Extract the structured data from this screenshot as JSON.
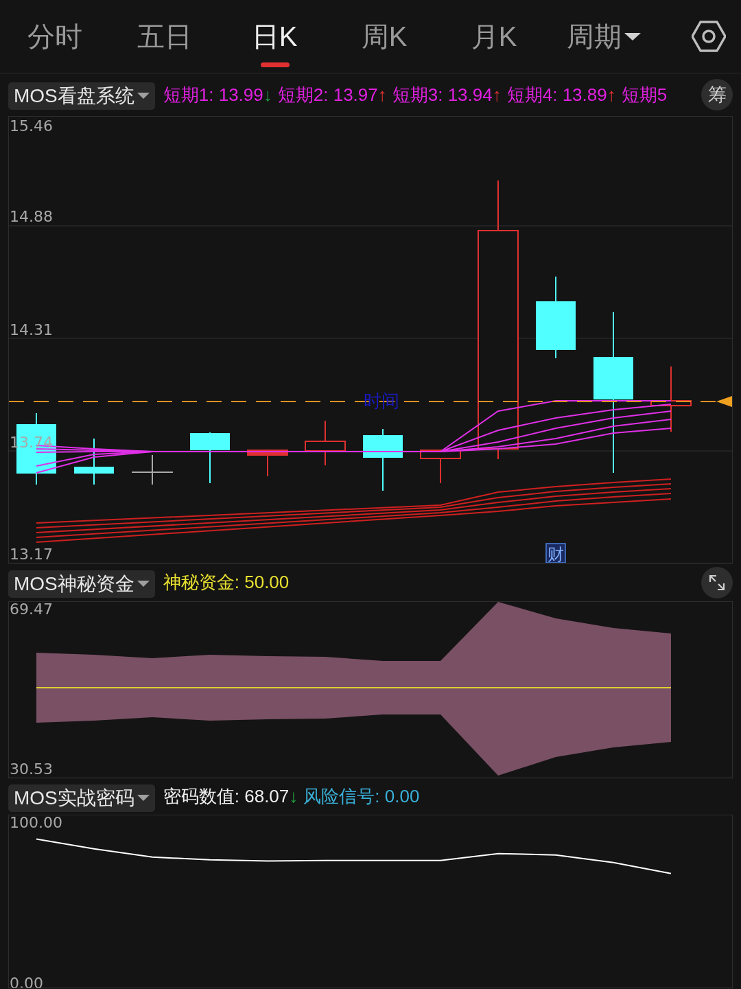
{
  "tabs": [
    {
      "label": "分时",
      "selected": false,
      "kind": "plain"
    },
    {
      "label": "五日",
      "selected": false,
      "kind": "plain"
    },
    {
      "label": "日K",
      "selected": true,
      "kind": "plain"
    },
    {
      "label": "周K",
      "selected": false,
      "kind": "plain"
    },
    {
      "label": "月K",
      "selected": false,
      "kind": "plain"
    },
    {
      "label": "周期",
      "selected": false,
      "kind": "dropdown"
    }
  ],
  "panels": [
    {
      "kind": "candles",
      "indicator": "MOS看盘系统",
      "tool": {
        "kind": "text",
        "text": "筹"
      },
      "legend": [
        {
          "text": "短期1: 13.99",
          "arrow": {
            "text": "↓",
            "color": "#20a040"
          },
          "color": "#e020e0"
        },
        {
          "text": "短期2: 13.97",
          "arrow": {
            "text": "↑",
            "color": "#e03030"
          },
          "color": "#e020e0"
        },
        {
          "text": "短期3: 13.94",
          "arrow": {
            "text": "↑",
            "color": "#e03030"
          },
          "color": "#e020e0"
        },
        {
          "text": "短期4: 13.89",
          "arrow": {
            "text": "↑",
            "color": "#e03030"
          },
          "color": "#e020e0"
        },
        {
          "text": "短期5",
          "color": "#e020e0"
        }
      ],
      "y_labels": [
        "15.46",
        "14.88",
        "14.31",
        "13.74",
        "13.17"
      ],
      "markers": {
        "time": "时间",
        "finance": "财"
      }
    },
    {
      "kind": "band",
      "indicator": "MOS神秘资金",
      "tool": {
        "kind": "expand"
      },
      "legend": [
        {
          "text": "神秘资金: 50.00",
          "color": "#e8e030"
        }
      ],
      "y_labels": [
        "69.47",
        "30.53"
      ]
    },
    {
      "kind": "line",
      "indicator": "MOS实战密码",
      "legend": [
        {
          "text": "密码数值: 68.07",
          "arrow": {
            "text": "↓",
            "color": "#20a040"
          },
          "color": "#f0f0f0"
        },
        {
          "text": "风险信号: 0.00",
          "color": "#3ab0d8"
        }
      ],
      "chart_data": {
        "type": "line",
        "ylim": [
          -3.6,
          104.9
        ],
        "yticks": [
          {
            "value": 100,
            "label": "100.00"
          },
          {
            "value": 0,
            "label": "0.00"
          }
        ],
        "series": [
          {
            "color": "#ffffff",
            "values": [
              89.7,
              83.6,
              78.4,
              76.7,
              75.9,
              76.3,
              76.3,
              76.3,
              80.6,
              79.7,
              75.0,
              68.1
            ]
          }
        ]
      }
    }
  ]
}
